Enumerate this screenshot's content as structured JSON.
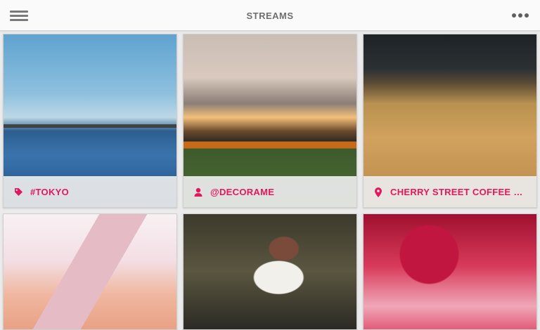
{
  "header": {
    "title": "STREAMS"
  },
  "icons": {
    "menu": "hamburger-menu-icon",
    "more": "more-dots-icon",
    "tag": "tag-icon",
    "user": "user-icon",
    "location": "location-pin-icon"
  },
  "colors": {
    "accent": "#e2185f",
    "header_text": "#6e6e6e"
  },
  "cards": [
    {
      "label": "#TOKYO",
      "icon": "tag-icon"
    },
    {
      "label": "@DECORAME",
      "icon": "user-icon"
    },
    {
      "label": "CHERRY STREET COFFEE HOUSE",
      "icon": "location-pin-icon"
    },
    {
      "label": "",
      "icon": ""
    },
    {
      "label": "",
      "icon": ""
    },
    {
      "label": "",
      "icon": ""
    }
  ]
}
